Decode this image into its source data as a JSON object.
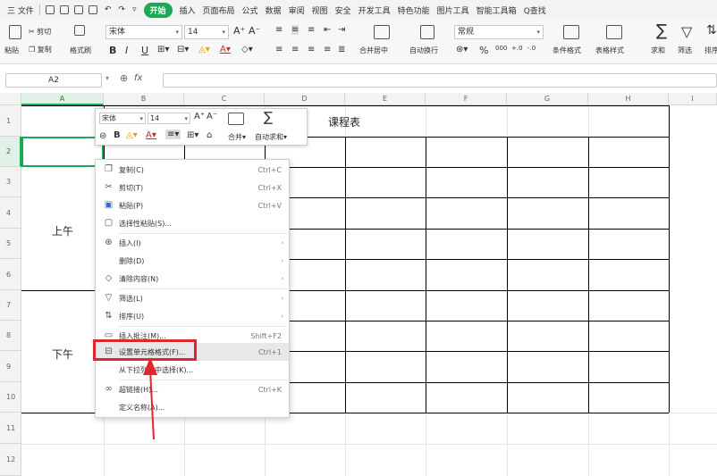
{
  "menubar": {
    "file": "三 文件",
    "tabs": [
      "开始",
      "插入",
      "页面布局",
      "公式",
      "数据",
      "审阅",
      "视图",
      "安全",
      "开发工具",
      "特色功能",
      "图片工具",
      "智能工具箱"
    ],
    "search": "Q查找"
  },
  "ribbon": {
    "paste": "粘贴",
    "cut": "剪切",
    "copy": "复制",
    "format_painter": "格式刷",
    "font_name": "宋体",
    "font_size": "14",
    "bold": "B",
    "italic": "I",
    "underline": "U",
    "grow_font": "A⁺",
    "shrink_font": "A⁻",
    "merge_center": "合并居中",
    "wrap_text": "自动换行",
    "number_format": "常规",
    "percent": "%",
    "thousands": "000",
    "conditional_format": "条件格式",
    "table_style": "表格样式",
    "sum": "求和",
    "filter": "筛选",
    "sort": "排序"
  },
  "formula_bar": {
    "cell_ref": "A2",
    "fx": "fx",
    "value": ""
  },
  "grid": {
    "columns": [
      "A",
      "B",
      "C",
      "D",
      "E",
      "F",
      "G",
      "H",
      "I"
    ],
    "rows": [
      "1",
      "2",
      "3",
      "4",
      "5",
      "6",
      "7",
      "8",
      "9",
      "10",
      "11",
      "12"
    ],
    "title": "课程表",
    "morning": "上午",
    "afternoon": "下午"
  },
  "mini_toolbar": {
    "font_name": "宋体",
    "font_size": "14",
    "grow": "A⁺",
    "shrink": "A⁻",
    "bold": "B",
    "merge": "合并",
    "autosum": "自动求和"
  },
  "context_menu": {
    "items": [
      {
        "label": "复制(C)",
        "shortcut": "Ctrl+C",
        "icon": "copy-icon"
      },
      {
        "label": "剪切(T)",
        "shortcut": "Ctrl+X",
        "icon": "scissors-icon"
      },
      {
        "label": "粘贴(P)",
        "shortcut": "Ctrl+V",
        "icon": "paste-icon"
      },
      {
        "label": "选择性粘贴(S)...",
        "shortcut": "",
        "icon": "paste-special-icon"
      },
      {
        "label": "插入(I)",
        "shortcut": "",
        "icon": "insert-icon"
      },
      {
        "label": "删除(D)",
        "shortcut": "",
        "icon": ""
      },
      {
        "label": "清除内容(N)",
        "shortcut": "",
        "icon": "eraser-icon"
      },
      {
        "label": "筛选(L)",
        "shortcut": "",
        "icon": "filter-icon"
      },
      {
        "label": "排序(U)",
        "shortcut": "",
        "icon": "sort-icon"
      },
      {
        "label": "插入批注(M)...",
        "shortcut": "Shift+F2",
        "icon": "comment-icon"
      },
      {
        "label": "设置单元格格式(F)...",
        "shortcut": "Ctrl+1",
        "icon": "format-cells-icon"
      },
      {
        "label": "从下拉列表中选择(K)...",
        "shortcut": "",
        "icon": ""
      },
      {
        "label": "超链接(H)...",
        "shortcut": "Ctrl+K",
        "icon": "link-icon"
      },
      {
        "label": "定义名称(A)...",
        "shortcut": "",
        "icon": ""
      }
    ],
    "highlighted_index": 10,
    "highlight_color": "#e3262e",
    "arrow_color": "#e3262e"
  },
  "colors": {
    "accent": "#1aaa55",
    "highlight": "#e3262e"
  }
}
